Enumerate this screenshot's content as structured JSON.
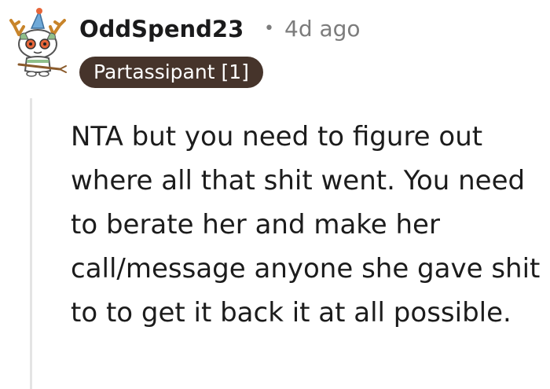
{
  "comment": {
    "author": "OddSpend23",
    "separator": "•",
    "timestamp": "4d ago",
    "flair": "Partassipant [1]",
    "avatar_icon": "snoo-avatar-icon",
    "body": "NTA but you need to figure out where all that shit went. You need to berate her and make her call/message anyone she gave shit to to get it back it at all possible."
  },
  "colors": {
    "flair_background": "#46342b",
    "flair_text": "#ffffff",
    "username": "#1a1a1b",
    "meta": "#7c7c7c",
    "body": "#1c1c1c",
    "thread_line": "#e4e4e4"
  }
}
